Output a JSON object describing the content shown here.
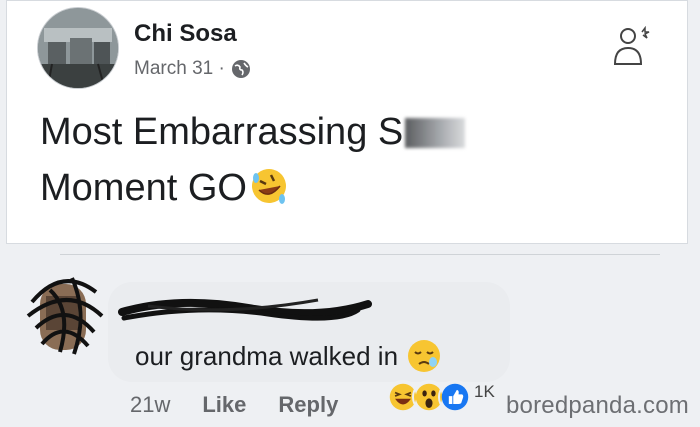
{
  "post": {
    "author_name": "Chi Sosa",
    "date": "March 31 ·",
    "text_line1": "Most Embarrassing S",
    "text_line2": "Moment GO"
  },
  "comment": {
    "text": "our grandma walked in",
    "time": "21w",
    "like_label": "Like",
    "reply_label": "Reply",
    "reaction_count": "1K",
    "reactions": [
      "haha-icon",
      "wow-icon",
      "like-icon"
    ]
  },
  "watermark": "boredpanda.com"
}
